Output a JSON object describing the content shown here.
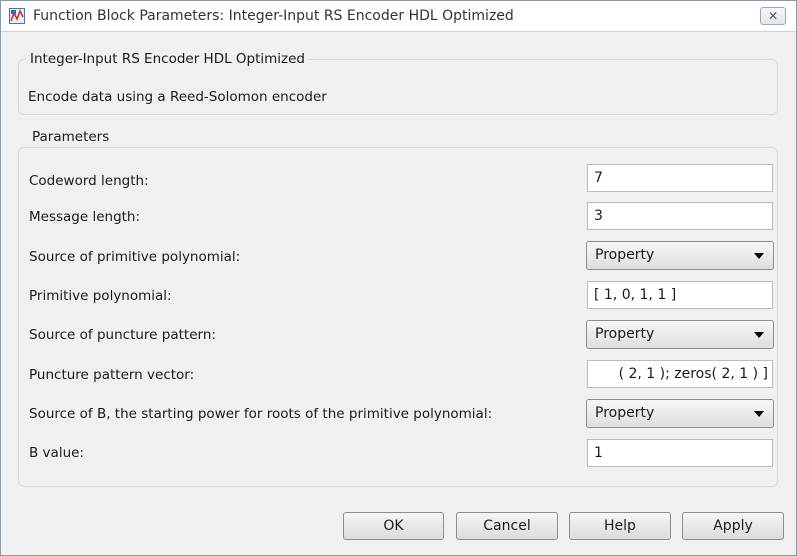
{
  "window": {
    "title": "Function Block Parameters: Integer-Input RS Encoder HDL Optimized",
    "close_symbol": "✕",
    "icon": "simulink-block-icon"
  },
  "block": {
    "name": "Integer-Input RS Encoder HDL Optimized",
    "description": "Encode data using a Reed-Solomon encoder"
  },
  "parameters": {
    "group_label": "Parameters",
    "codeword_length": {
      "label": "Codeword length:",
      "value": "7"
    },
    "message_length": {
      "label": "Message length:",
      "value": "3"
    },
    "primitive_poly_source": {
      "label": "Source of primitive polynomial:",
      "value": "Property"
    },
    "primitive_polynomial": {
      "label": "Primitive polynomial:",
      "value": "[ 1, 0, 1, 1 ]"
    },
    "puncture_source": {
      "label": "Source of puncture pattern:",
      "value": "Property"
    },
    "puncture_vector": {
      "label": "Puncture pattern vector:",
      "value": "( 2, 1 ); zeros( 2, 1 ) ]"
    },
    "b_source": {
      "label": "Source of B, the starting power for roots of the primitive polynomial:",
      "value": "Property"
    },
    "b_value": {
      "label": "B value:",
      "value": "1"
    }
  },
  "buttons": {
    "ok": "OK",
    "cancel": "Cancel",
    "help": "Help",
    "apply": "Apply"
  }
}
